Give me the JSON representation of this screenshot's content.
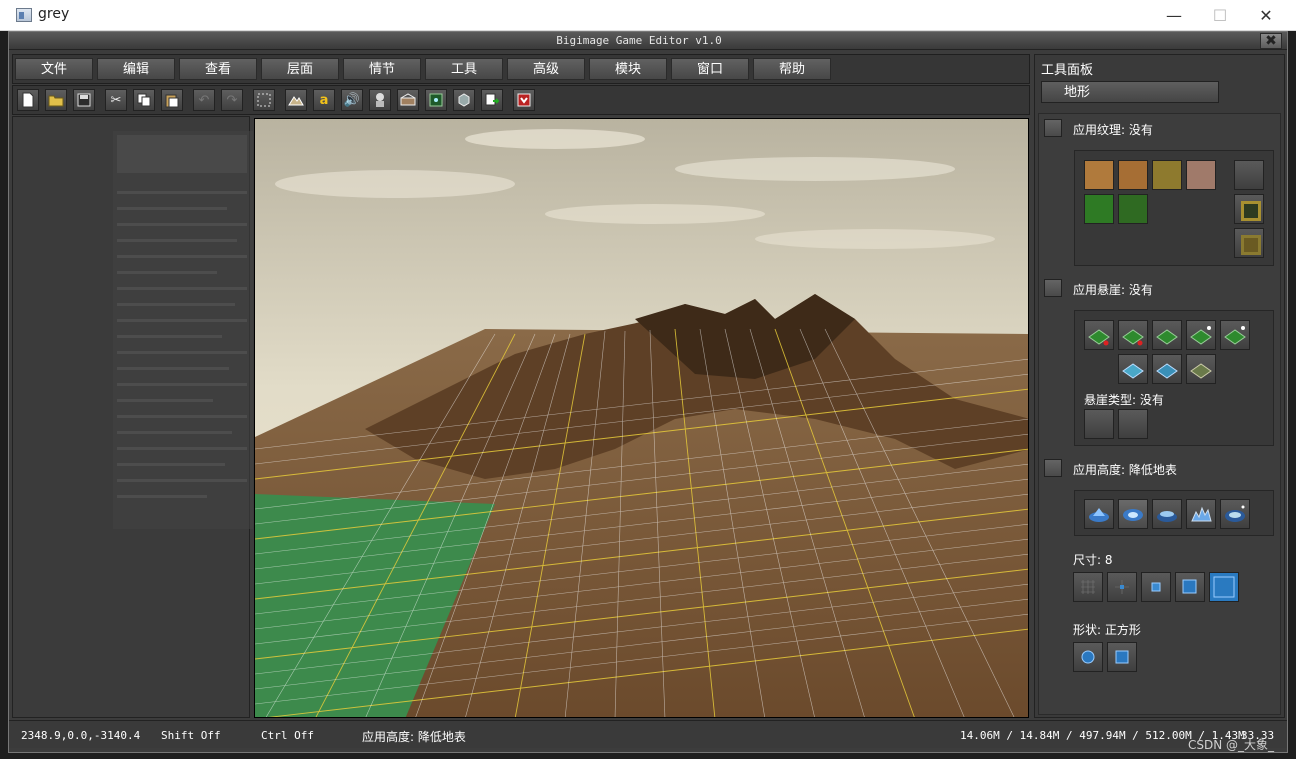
{
  "window": {
    "title": "grey",
    "minimize": "—",
    "maximize": "☐",
    "close": "✕"
  },
  "editor": {
    "title": "Bigimage Game Editor v1.0",
    "close": "✖"
  },
  "menu": {
    "file": "文件",
    "edit": "编辑",
    "view": "查看",
    "layer": "层面",
    "story": "情节",
    "tools": "工具",
    "advanced": "高级",
    "module": "模块",
    "window": "窗口",
    "help": "帮助"
  },
  "toolbar": {
    "items": [
      "new-file",
      "open",
      "save",
      "cut",
      "copy",
      "paste",
      "undo",
      "redo",
      "select",
      "terrain",
      "text",
      "sound",
      "character",
      "building",
      "map",
      "object",
      "export",
      "close"
    ]
  },
  "right_panel": {
    "title": "工具面板",
    "tab": "地形",
    "texture_label": "应用纹理: 没有",
    "cliff_label": "应用悬崖: 没有",
    "cliff_type_label": "悬崖类型: 没有",
    "height_label": "应用高度: 降低地表",
    "size_label": "尺寸: 8",
    "shape_label": "形状: 正方形",
    "texture_colors": [
      "#b07a3c",
      "#a66e34",
      "#8e7a2e",
      "#a07a6a",
      "#2e7a24",
      "#2f6a22"
    ]
  },
  "status": {
    "coords": "2348.9,0.0,-3140.4",
    "shift": "Shift Off",
    "ctrl": "Ctrl Off",
    "action": "应用高度: 降低地表",
    "memory": "14.06M / 14.84M / 497.94M / 512.00M / 1.43M",
    "fps": "33.33"
  },
  "watermark": "CSDN @_大象_",
  "colors": {
    "sky": "#cfc7b0",
    "ground": "#7a5634",
    "grass": "#3d8a4c",
    "grid_white": "#ffffff",
    "grid_yellow": "#e8cc3a"
  }
}
